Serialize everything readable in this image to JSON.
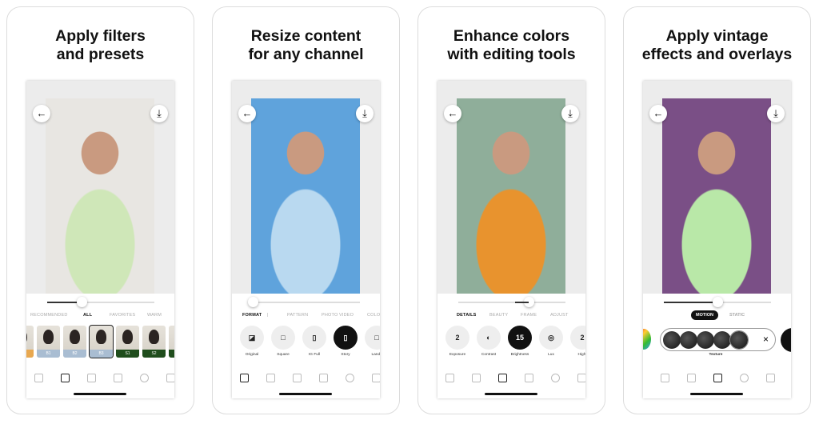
{
  "panels": [
    {
      "title": "Apply filters\nand presets",
      "photo_colors": [
        "#e8e6e2",
        "#cfe7b8"
      ],
      "slider_value": 0.32,
      "tabs": [
        {
          "label": "RECOMMENDED"
        },
        {
          "label": "ALL",
          "active": true
        },
        {
          "label": "FAVORITES"
        },
        {
          "label": "WARM"
        }
      ],
      "filters": [
        {
          "label": "",
          "color": "#e8a850"
        },
        {
          "label": "B1",
          "color": "#a9bdd2"
        },
        {
          "label": "B2",
          "color": "#a9bdd2"
        },
        {
          "label": "B3",
          "color": "#a9bdd2",
          "selected": true
        },
        {
          "label": "S1",
          "color": "#1f4d1c"
        },
        {
          "label": "S2",
          "color": "#1f4d1c"
        },
        {
          "label": "",
          "color": "#1f4d1c"
        }
      ],
      "active_tool": 1
    },
    {
      "title": "Resize content\nfor any channel",
      "photo_colors": [
        "#5fa3dc",
        "#b9d9f0"
      ],
      "slider_value": 0.0,
      "tabs": [
        {
          "label": "FORMAT",
          "active": true
        },
        {
          "label": "|"
        },
        {
          "label": "PATTERN"
        },
        {
          "label": "PHOTO"
        },
        {
          "label": "VIDEO"
        },
        {
          "label": "COLO"
        }
      ],
      "options": [
        {
          "label": "Original",
          "icon": "◪"
        },
        {
          "label": "Square",
          "icon": "□"
        },
        {
          "label": "IG Full",
          "icon": "▯"
        },
        {
          "label": "Story",
          "icon": "▯",
          "active": true
        },
        {
          "label": "Lands",
          "icon": "□"
        }
      ],
      "active_tool": 0
    },
    {
      "title": "Enhance colors\nwith editing tools",
      "photo_colors": [
        "#8fae9a",
        "#e8932e"
      ],
      "slider_value": 0.66,
      "tabs": [
        {
          "label": "DETAILS",
          "active": true
        },
        {
          "label": "BEAUTY"
        },
        {
          "label": "FRAME"
        },
        {
          "label": "ADJUST"
        }
      ],
      "options": [
        {
          "label": "Exposure",
          "icon": "2"
        },
        {
          "label": "Contrast",
          "icon": "◐"
        },
        {
          "label": "Brightness",
          "icon": "15",
          "active": true
        },
        {
          "label": "Lux",
          "icon": "◎"
        },
        {
          "label": "Highl",
          "icon": "2"
        }
      ],
      "active_tool": 2
    },
    {
      "title": "Apply vintage\neffects and overlays",
      "photo_colors": [
        "#7a4f86",
        "#b9e8a8"
      ],
      "slider_value": 0.5,
      "tabs": [
        {
          "label": "MOTION",
          "active": true
        },
        {
          "label": "STATIC"
        }
      ],
      "overlay_group_label": "Texture",
      "overlay_next_label": "Vi",
      "close_icon": "×",
      "active_tool": 3
    }
  ],
  "icons": {
    "back": "←",
    "download": "⤓"
  },
  "tool_names": [
    "crop-icon",
    "filters-icon",
    "adjust-icon",
    "overlay-icon",
    "text-icon",
    "layout-icon"
  ]
}
